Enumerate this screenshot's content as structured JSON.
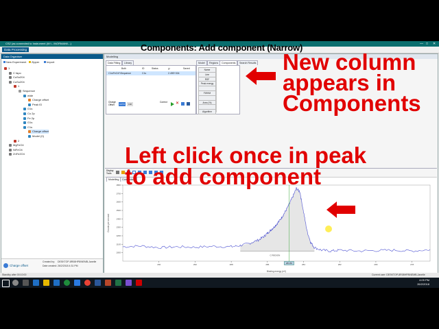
{
  "window": {
    "title": "CS2 (as connected to Instrument (W:\\...\\NORMAN\\\\...)",
    "min_icon": "—",
    "max_icon": "□",
    "close_icon": "✕"
  },
  "menu": {
    "data_processing": "Data Processing"
  },
  "overlay": {
    "title": "Components: Add component (Narrow)",
    "annotation1_lines": [
      "New column",
      "appears in",
      "Components"
    ],
    "annotation2_lines": [
      "Left click once in peak",
      "to add component"
    ]
  },
  "left_panel": {
    "header": "Data Organiser",
    "toolbar": {
      "new_experiment": "New Experiment",
      "zipper": "Zipper",
      "import": "Import"
    },
    "tree": [
      {
        "label": "1",
        "indent": 0,
        "color": "#c0392b"
      },
      {
        "label": "C fapo",
        "indent": 1,
        "color": "#777"
      },
      {
        "label": "CuSo204",
        "indent": 1,
        "color": "#777"
      },
      {
        "label": "CuSo204",
        "indent": 1,
        "color": "#777"
      },
      {
        "label": "1",
        "indent": 2,
        "color": "#c0392b"
      },
      {
        "label": "Sequence",
        "indent": 3,
        "color": "#999"
      },
      {
        "label": "wide",
        "indent": 4,
        "color": "#2e86c1"
      },
      {
        "label": "Charge offset",
        "indent": 5,
        "color": "#e67e22"
      },
      {
        "label": "Peak ID",
        "indent": 5,
        "color": "#2e86c1"
      },
      {
        "label": "O1s",
        "indent": 4,
        "color": "#2e86c1"
      },
      {
        "label": "Cu 2p",
        "indent": 4,
        "color": "#2e86c1"
      },
      {
        "label": "Fe 2p",
        "indent": 4,
        "color": "#2e86c1"
      },
      {
        "label": "O1s",
        "indent": 4,
        "color": "#2e86c1"
      },
      {
        "label": "C1s",
        "indent": 4,
        "color": "#2e86c1"
      },
      {
        "label": "Charge offset",
        "indent": 5,
        "color": "#e67e22",
        "selected": true
      },
      {
        "label": "Model (0)",
        "indent": 5,
        "color": "#2e86c1"
      },
      {
        "label": "2",
        "indent": 2,
        "color": "#c0392b"
      },
      {
        "label": "MgFeO4",
        "indent": 1,
        "color": "#777"
      },
      {
        "label": "NiFeO4",
        "indent": 1,
        "color": "#777"
      },
      {
        "label": "ZnFe2O4",
        "indent": 1,
        "color": "#777"
      }
    ],
    "footer": {
      "name": "Charge offset",
      "created_by_label": "Created by:",
      "created_by": "DESKTOP-8R08HP8\\NEMB-Janelle",
      "date_label": "Date created:",
      "date": "26/2/2018 4:31 PM"
    }
  },
  "modelling": {
    "header": "Modelling",
    "top_tabs": [
      "Data Fitting",
      "Library"
    ],
    "right_tabs": [
      "Model",
      "Regions",
      "Components",
      "Search Results"
    ],
    "quant_columns": [
      "Both",
      "ID",
      "Status",
      "χ²",
      "Saved"
    ],
    "quant_row": [
      "C1s/FeO4*\\Sequence",
      "C1s",
      "",
      "2.49E+004",
      ""
    ],
    "components_cmds": [
      "Name",
      "Line",
      "RSF",
      "Peak energy",
      "",
      "FWHM",
      "",
      "Area (%)",
      "",
      "Algorithm"
    ],
    "bottom_labels": {
      "charge_offset": "Charge Offset",
      "auto": "AUTO",
      "lm": "LM",
      "correct": "Correct"
    },
    "plot_toolbar": {
      "display_tools": "Display Tools"
    },
    "plot_tabs": [
      "Modelling",
      "Comparison"
    ]
  },
  "chart_data": {
    "type": "line",
    "xlabel": "Binding energy (eV)",
    "ylabel": "Counts per second",
    "x_reversed": true,
    "xlim": [
      294,
      277
    ],
    "ylim": [
      900,
      1800
    ],
    "x_ticks": [
      292,
      290,
      288,
      286,
      284,
      282,
      280,
      278
    ],
    "y_ticks": [
      1000,
      1100,
      1200,
      1300,
      1400,
      1500,
      1600,
      1700,
      1800
    ],
    "series": [
      {
        "color": "#4a4fd1",
        "x": [
          294,
          293,
          292,
          291,
          290,
          289,
          288,
          287.5,
          287,
          286.5,
          286.2,
          286,
          285.8,
          285.6,
          285.4,
          285.2,
          285,
          284.8,
          284.6,
          284.4,
          284.2,
          284,
          283.8,
          283.6,
          283.4,
          283,
          282.5,
          282,
          281,
          280,
          279,
          278,
          277
        ],
        "values": [
          1070,
          1080,
          1060,
          1070,
          1065,
          1075,
          1070,
          1085,
          1110,
          1150,
          1190,
          1230,
          1270,
          1310,
          1360,
          1420,
          1490,
          1570,
          1660,
          1760,
          1720,
          1480,
          1250,
          1120,
          1060,
          1030,
          1020,
          1030,
          1020,
          1025,
          1030,
          1020,
          1035
        ]
      }
    ],
    "region_label": "C REGION",
    "region_value": "284.80",
    "background_level": 1020
  },
  "status": {
    "left": "Standby after 00:10:00",
    "right": "Current user: DESKTOP-8R08HP8\\NEMB-Janelle"
  },
  "taskbar": {
    "time": "4:09 PM",
    "date": "26/2/2018"
  }
}
